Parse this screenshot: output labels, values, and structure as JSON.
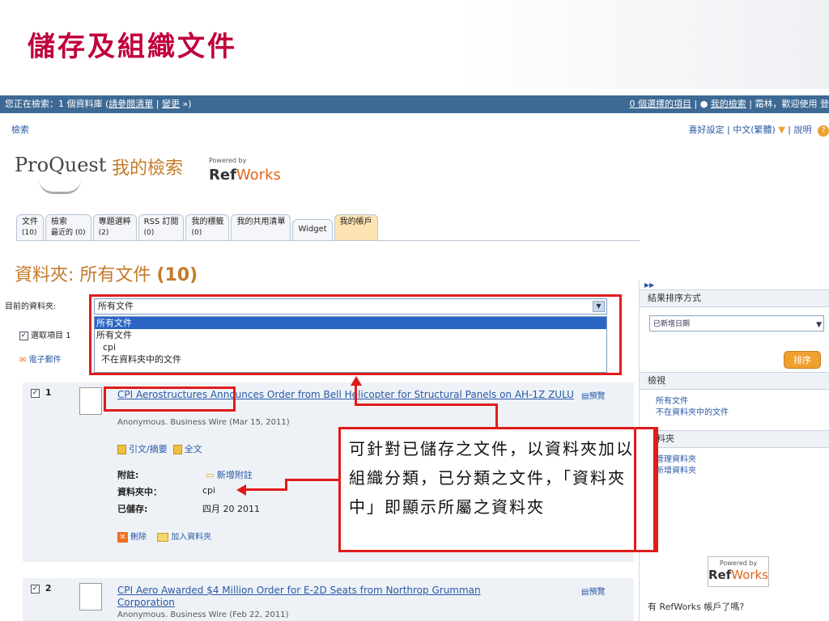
{
  "slide": {
    "title": "儲存及組織文件"
  },
  "topbar": {
    "left_prefix": "您正在檢索：1 個資料庫 (",
    "view_list": "請參閱清單",
    "sep": " | ",
    "change": "變更",
    "left_suffix": " »)",
    "selected_items": "0 個選擇的項目",
    "my_search": "我的檢索",
    "welcome": "霜林，歡迎使用 登"
  },
  "nav": {
    "search": "檢索",
    "preferences": "喜好設定",
    "language": "中文(繁體)",
    "help": "說明"
  },
  "brand": {
    "logo": "ProQuest",
    "my_search": "我的檢索",
    "powered_by": "Powered by",
    "refworks_ref": "Ref",
    "refworks_works": "Works"
  },
  "tabs": [
    {
      "label": "文件",
      "count": "(10)",
      "active": false
    },
    {
      "label": "檢索",
      "count": "最近的 (0)",
      "active": false
    },
    {
      "label": "專題選粹",
      "count": "(2)",
      "active": false
    },
    {
      "label": "RSS 訂閱",
      "count": "(0)",
      "active": false
    },
    {
      "label": "我的標籤",
      "count": "(0)",
      "active": false
    },
    {
      "label": "我的共用清單",
      "count": "",
      "active": false
    },
    {
      "label": "Widget",
      "count": "",
      "active": false
    },
    {
      "label": "我的帳戶",
      "count": "",
      "active": true
    }
  ],
  "folder": {
    "heading": "資料夾: 所有文件",
    "count": "(10)",
    "current_label": "目前的資料夾:",
    "selected": "所有文件",
    "options": [
      "所有文件",
      "所有文件",
      "cpi",
      "不在資料夾中的文件"
    ],
    "select_items": "選取項目 1",
    "email": "電子郵件"
  },
  "records": [
    {
      "num": "1",
      "title": "CPI Aerostructures Announces Order from Bell Helicopter for Structural Panels on AH-1Z ZULU",
      "preview": "預覽",
      "meta": "Anonymous. Business Wire (Mar 15, 2011)",
      "cite_abstract": "引文/摘要",
      "fulltext": "全文",
      "note_label": "附註:",
      "note_value": "新增附註",
      "folder_label": "資料夾中：",
      "folder_value": "cpi",
      "saved_label": "已儲存:",
      "saved_value": "四月 20 2011",
      "delete": "刪除",
      "add_to_folder": "加入資料夾"
    },
    {
      "num": "2",
      "title": "CPI Aero Awarded $4 Million Order for E-2D Seats from Northrop Grumman Corporation",
      "preview": "預覽",
      "meta": "Anonymous. Business Wire (Feb 22, 2011)"
    }
  ],
  "sidebar": {
    "sort_heading": "結果排序方式",
    "sort_value": "已新增日期",
    "sort_button": "排序",
    "view_heading": "檢視",
    "view_links": [
      "所有文件",
      "不在資料夾中的文件"
    ],
    "folders_heading": "資料夾",
    "folder_links": [
      "管理資料夾",
      "新增資料夾"
    ],
    "powered_by": "Powered by",
    "refworks_ref": "Ref",
    "refworks_works": "Works",
    "account_question": "有 RefWorks 帳戶了嗎?"
  },
  "callout": {
    "text": "可針對已儲存之文件，以資料夾加以組織分類，已分類之文件，「資料夾中」即顯示所屬之資料夾"
  },
  "colors": {
    "title": "#c0003c",
    "accent": "#c47a2a",
    "highlight": "#e11b1b",
    "link": "#2a58a5"
  }
}
